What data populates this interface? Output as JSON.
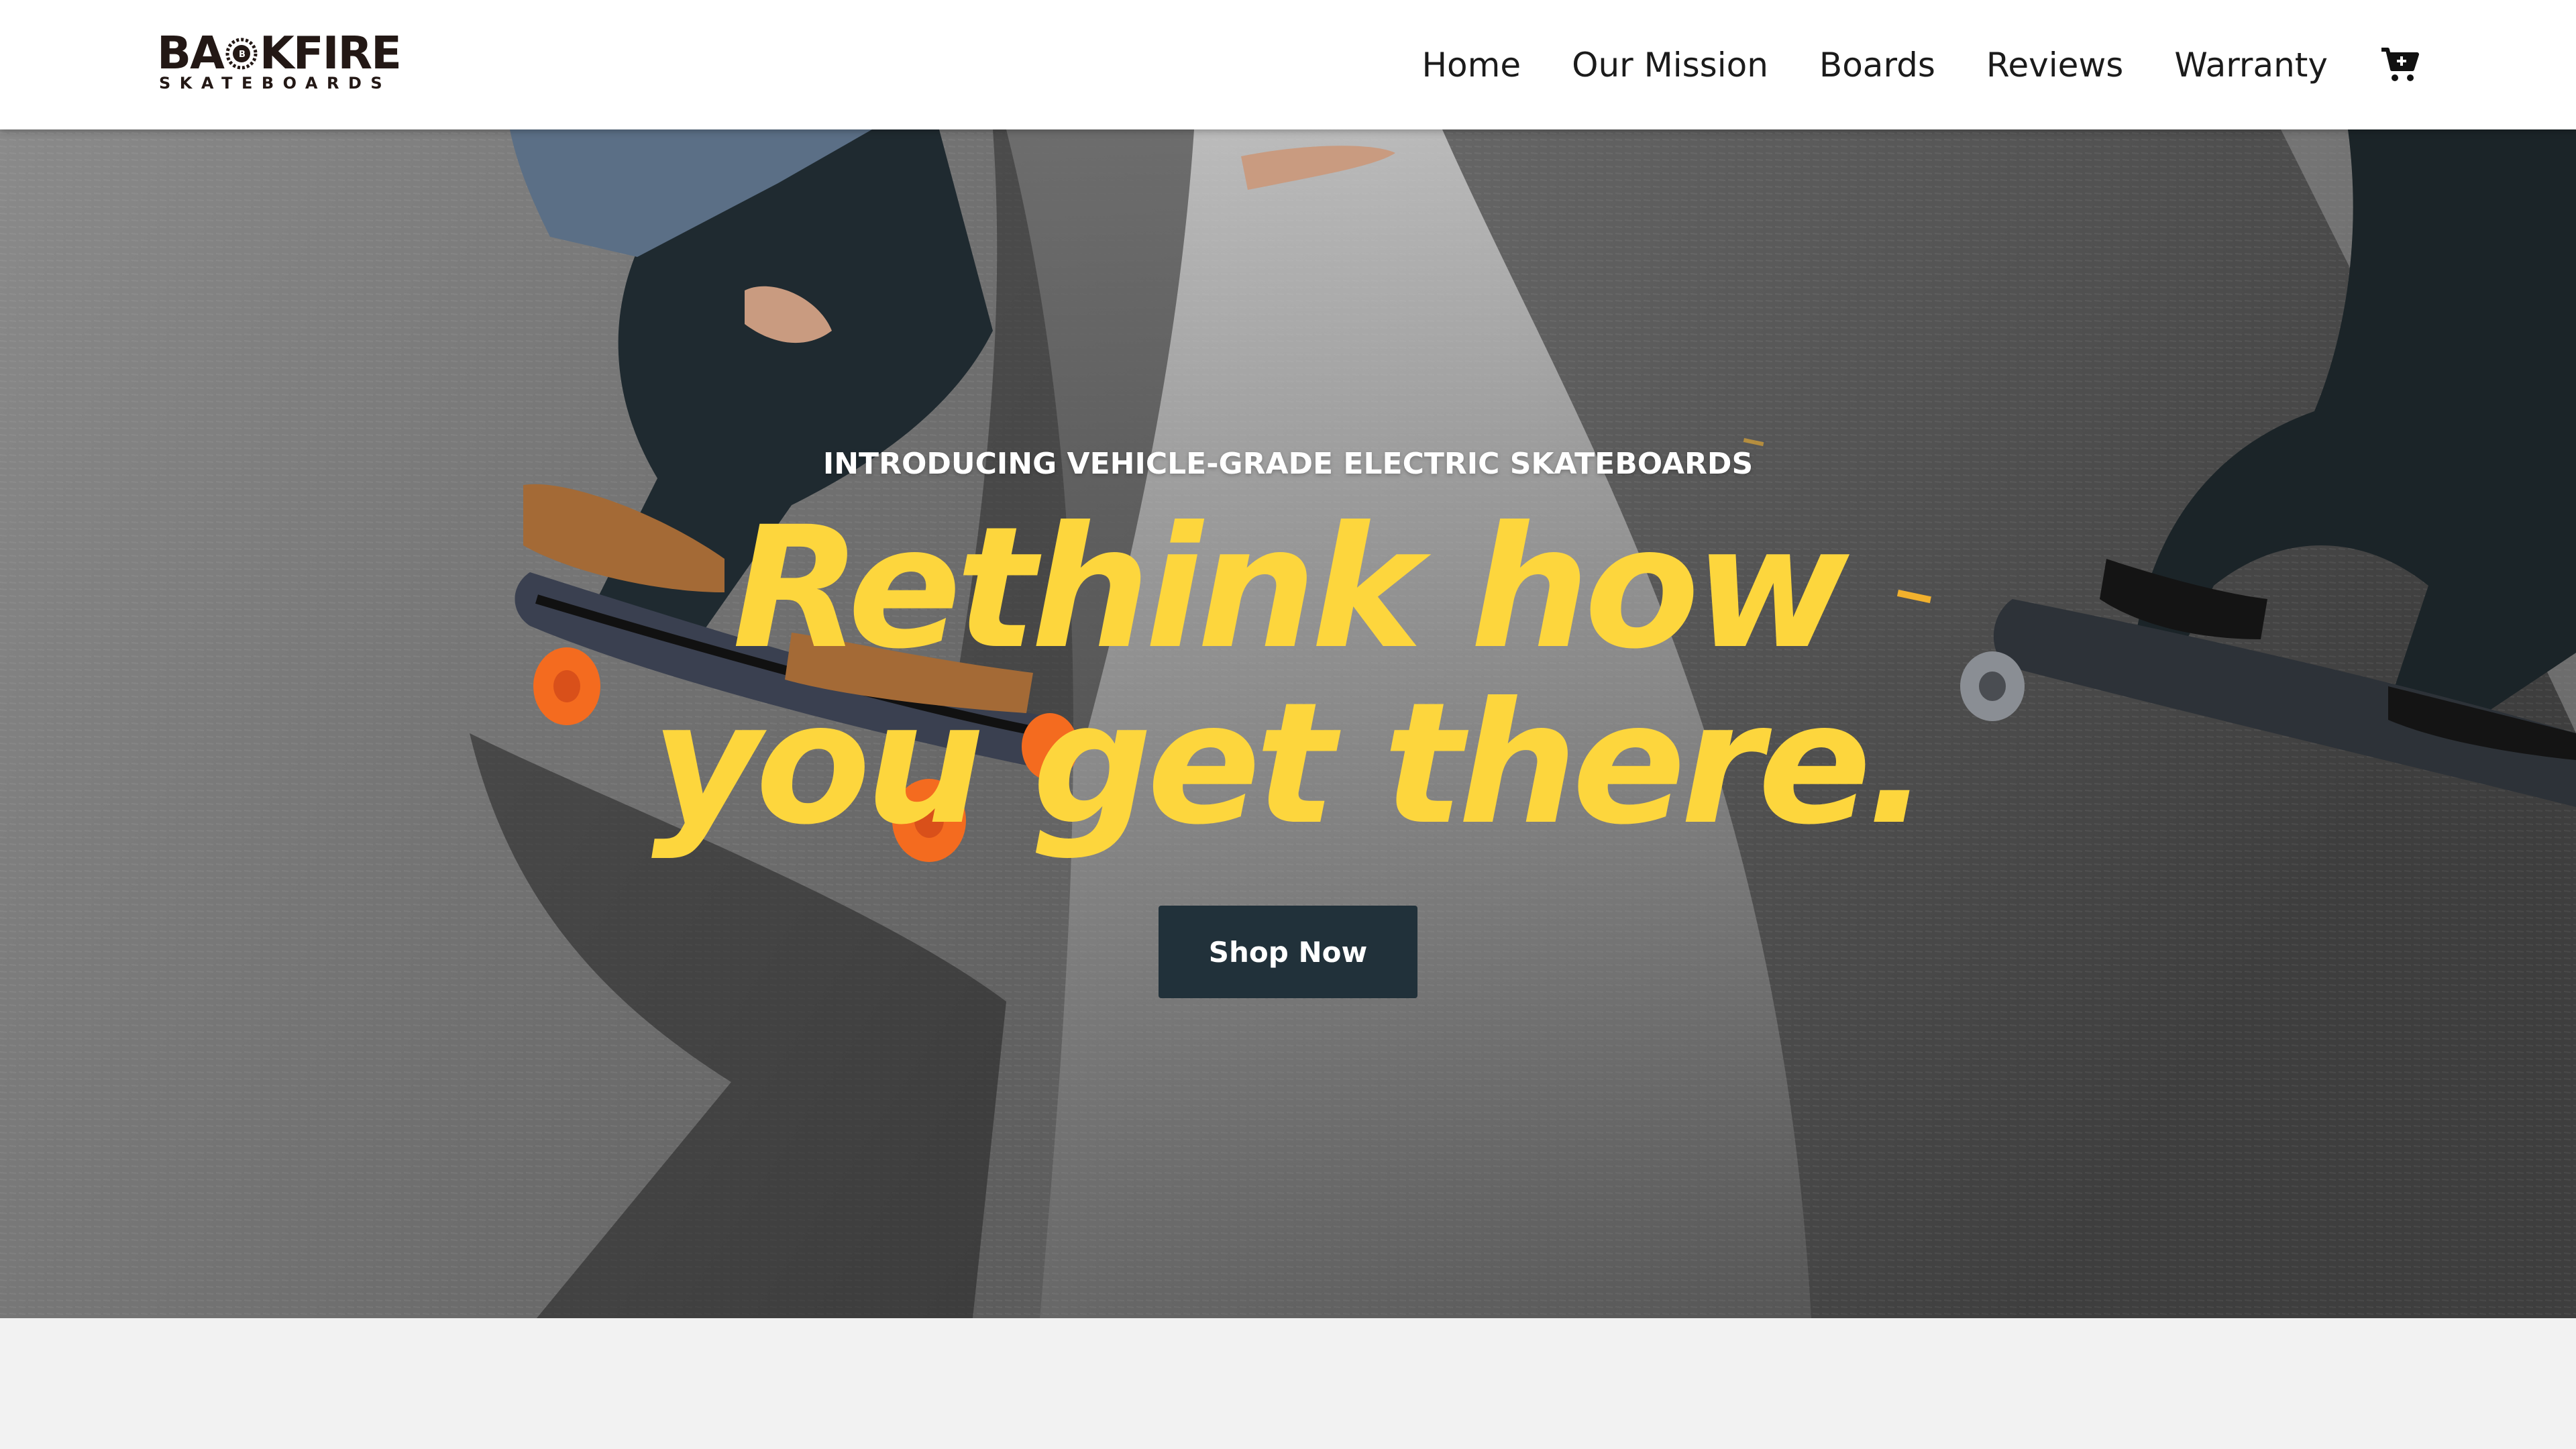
{
  "brand": {
    "logo_word_left": "BA",
    "logo_word_right": "KFIRE",
    "logo_sub": "SKATEBOARDS",
    "logo_color": "#231815"
  },
  "nav": {
    "items": [
      {
        "label": "Home"
      },
      {
        "label": "Our Mission"
      },
      {
        "label": "Boards"
      },
      {
        "label": "Reviews"
      },
      {
        "label": "Warranty"
      }
    ],
    "cart_icon": "shopping-cart-plus-icon"
  },
  "hero": {
    "eyebrow": "INTRODUCING VEHICLE-GRADE ELECTRIC SKATEBOARDS",
    "headline_line1": "Rethink how",
    "headline_line2": "you get there.",
    "cta_label": "Shop Now",
    "headline_color": "#fdd63d",
    "cta_color": "#21313a",
    "image_description_icon": "skateboarders-photo"
  }
}
